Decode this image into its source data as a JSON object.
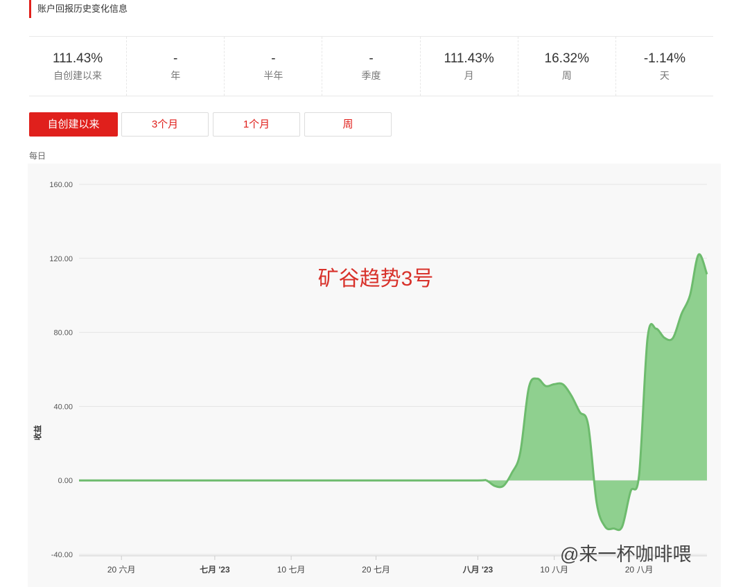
{
  "header": {
    "title": "账户回报历史变化信息"
  },
  "stats": [
    {
      "value": "111.43%",
      "label": "自创建以来"
    },
    {
      "value": "-",
      "label": "年"
    },
    {
      "value": "-",
      "label": "半年"
    },
    {
      "value": "-",
      "label": "季度"
    },
    {
      "value": "111.43%",
      "label": "月"
    },
    {
      "value": "16.32%",
      "label": "周"
    },
    {
      "value": "-1.14%",
      "label": "天"
    }
  ],
  "tabs": [
    "自创建以来",
    "3个月",
    "1个月",
    "周"
  ],
  "period_label": "每日",
  "watermark": "@来一杯咖啡喂",
  "colors": {
    "accent": "#e0201c",
    "area_fill": "#8fd08f",
    "area_line": "#6dbb6d"
  },
  "chart_data": {
    "type": "area",
    "title": "矿谷趋势3号",
    "ylabel": "收益",
    "ylim": [
      -40,
      160
    ],
    "yticks": [
      "-40.00",
      "0.00",
      "40.00",
      "80.00",
      "120.00",
      "160.00"
    ],
    "ytick_values": [
      -40,
      0,
      40,
      80,
      120,
      160
    ],
    "xlim": [
      "2023-06-15",
      "2023-08-28"
    ],
    "xticks": [
      {
        "label": "20 六月",
        "date": "2023-06-20",
        "bold": false
      },
      {
        "label": "七月 '23",
        "date": "2023-07-01",
        "bold": true
      },
      {
        "label": "10 七月",
        "date": "2023-07-10",
        "bold": false
      },
      {
        "label": "20 七月",
        "date": "2023-07-20",
        "bold": false
      },
      {
        "label": "八月 '23",
        "date": "2023-08-01",
        "bold": true
      },
      {
        "label": "10 八月",
        "date": "2023-08-10",
        "bold": false
      },
      {
        "label": "20 八月",
        "date": "2023-08-20",
        "bold": false
      }
    ],
    "grid": true,
    "series": [
      {
        "x": [
          "2023-06-15",
          "2023-06-25",
          "2023-07-05",
          "2023-07-15",
          "2023-07-25",
          "2023-08-01",
          "2023-08-02",
          "2023-08-03",
          "2023-08-04",
          "2023-08-05",
          "2023-08-06",
          "2023-08-07",
          "2023-08-08",
          "2023-08-09",
          "2023-08-10",
          "2023-08-11",
          "2023-08-12",
          "2023-08-13",
          "2023-08-14",
          "2023-08-15",
          "2023-08-16",
          "2023-08-17",
          "2023-08-18",
          "2023-08-19",
          "2023-08-20",
          "2023-08-21",
          "2023-08-22",
          "2023-08-23",
          "2023-08-24",
          "2023-08-25",
          "2023-08-26",
          "2023-08-27",
          "2023-08-28"
        ],
        "values": [
          0,
          0,
          0,
          0,
          0,
          0,
          0,
          -3,
          -3,
          4,
          15,
          50,
          55,
          51,
          52,
          52,
          46,
          37,
          30,
          -12,
          -25,
          -26,
          -25,
          -6,
          3,
          77,
          82,
          77,
          77,
          90,
          100,
          122,
          111.43
        ]
      }
    ]
  }
}
